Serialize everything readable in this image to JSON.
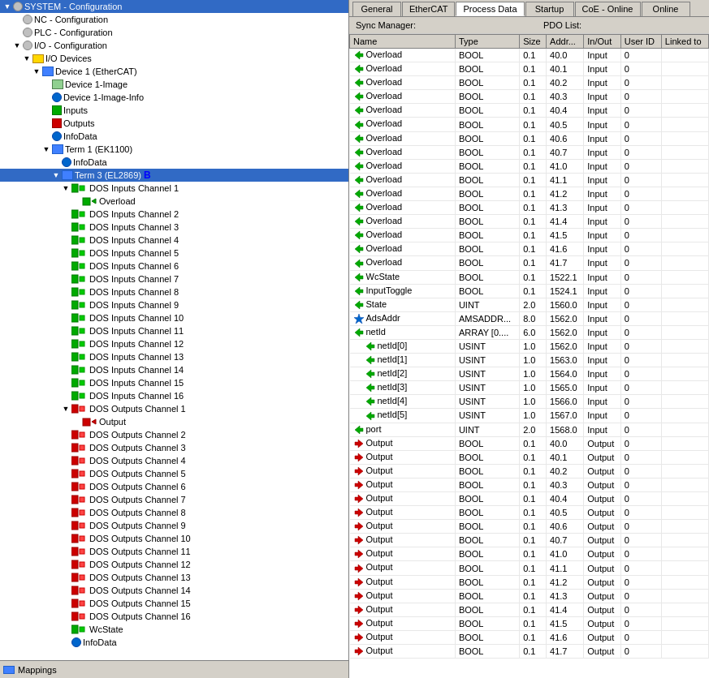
{
  "tabs": [
    {
      "label": "General",
      "active": false
    },
    {
      "label": "EtherCAT",
      "active": false
    },
    {
      "label": "Process Data",
      "active": true
    },
    {
      "label": "Startup",
      "active": false
    },
    {
      "label": "CoE - Online",
      "active": false
    },
    {
      "label": "Online",
      "active": false
    }
  ],
  "sync_manager_label": "Sync Manager:",
  "pdo_list_label": "PDO List:",
  "table_headers": [
    "Name",
    "Type",
    "Size",
    "Addr...",
    "In/Out",
    "User ID",
    "Linked to"
  ],
  "left_panel": {
    "tree": [
      {
        "id": "system",
        "label": "SYSTEM - Configuration",
        "indent": 0,
        "icon": "gear",
        "expand": true
      },
      {
        "id": "nc",
        "label": "NC - Configuration",
        "indent": 1,
        "icon": "gear",
        "expand": true
      },
      {
        "id": "plc",
        "label": "PLC - Configuration",
        "indent": 1,
        "icon": "gear",
        "expand": true
      },
      {
        "id": "io",
        "label": "I/O - Configuration",
        "indent": 1,
        "icon": "gear",
        "expand": true
      },
      {
        "id": "io-devices",
        "label": "I/O Devices",
        "indent": 2,
        "icon": "folder",
        "expand": true
      },
      {
        "id": "device1",
        "label": "Device 1 (EtherCAT)",
        "indent": 3,
        "icon": "device",
        "expand": true
      },
      {
        "id": "device1-image",
        "label": "Device 1-Image",
        "indent": 4,
        "icon": "image",
        "expand": false
      },
      {
        "id": "device1-image-info",
        "label": "Device 1-Image-Info",
        "indent": 4,
        "icon": "info",
        "expand": false
      },
      {
        "id": "inputs",
        "label": "Inputs",
        "indent": 4,
        "icon": "input-green",
        "expand": false
      },
      {
        "id": "outputs",
        "label": "Outputs",
        "indent": 4,
        "icon": "output-red",
        "expand": false
      },
      {
        "id": "infodata",
        "label": "InfoData",
        "indent": 4,
        "icon": "info-blue",
        "expand": false
      },
      {
        "id": "term1",
        "label": "Term 1 (EK1100)",
        "indent": 4,
        "icon": "device",
        "expand": true
      },
      {
        "id": "term1-infodata",
        "label": "InfoData",
        "indent": 5,
        "icon": "info-blue",
        "expand": false
      },
      {
        "id": "term3",
        "label": "Term 3 (EL2869)",
        "indent": 5,
        "icon": "device",
        "expand": true,
        "selected": true
      },
      {
        "id": "dos-ch1",
        "label": "DOS Inputs Channel 1",
        "indent": 6,
        "icon": "channel-green",
        "expand": true
      },
      {
        "id": "overload",
        "label": "Overload",
        "indent": 7,
        "icon": "overload-green",
        "expand": false
      },
      {
        "id": "dos-ch2",
        "label": "DOS Inputs Channel 2",
        "indent": 6,
        "icon": "channel-green",
        "expand": false
      },
      {
        "id": "dos-ch3",
        "label": "DOS Inputs Channel 3",
        "indent": 6,
        "icon": "channel-green",
        "expand": false
      },
      {
        "id": "dos-ch4",
        "label": "DOS Inputs Channel 4",
        "indent": 6,
        "icon": "channel-green",
        "expand": false
      },
      {
        "id": "dos-ch5",
        "label": "DOS Inputs Channel 5",
        "indent": 6,
        "icon": "channel-green",
        "expand": false
      },
      {
        "id": "dos-ch6",
        "label": "DOS Inputs Channel 6",
        "indent": 6,
        "icon": "channel-green",
        "expand": false
      },
      {
        "id": "dos-ch7",
        "label": "DOS Inputs Channel 7",
        "indent": 6,
        "icon": "channel-green",
        "expand": false
      },
      {
        "id": "dos-ch8",
        "label": "DOS Inputs Channel 8",
        "indent": 6,
        "icon": "channel-green",
        "expand": false
      },
      {
        "id": "dos-ch9",
        "label": "DOS Inputs Channel 9",
        "indent": 6,
        "icon": "channel-green",
        "expand": false
      },
      {
        "id": "dos-ch10",
        "label": "DOS Inputs Channel 10",
        "indent": 6,
        "icon": "channel-green",
        "expand": false
      },
      {
        "id": "dos-ch11",
        "label": "DOS Inputs Channel 11",
        "indent": 6,
        "icon": "channel-green",
        "expand": false
      },
      {
        "id": "dos-ch12",
        "label": "DOS Inputs Channel 12",
        "indent": 6,
        "icon": "channel-green",
        "expand": false
      },
      {
        "id": "dos-ch13",
        "label": "DOS Inputs Channel 13",
        "indent": 6,
        "icon": "channel-green",
        "expand": false
      },
      {
        "id": "dos-ch14",
        "label": "DOS Inputs Channel 14",
        "indent": 6,
        "icon": "channel-green",
        "expand": false
      },
      {
        "id": "dos-ch15",
        "label": "DOS Inputs Channel 15",
        "indent": 6,
        "icon": "channel-green",
        "expand": false
      },
      {
        "id": "dos-ch16",
        "label": "DOS Inputs Channel 16",
        "indent": 6,
        "icon": "channel-green",
        "expand": false
      },
      {
        "id": "dos-out-ch1",
        "label": "DOS Outputs Channel 1",
        "indent": 6,
        "icon": "channel-red",
        "expand": true
      },
      {
        "id": "output",
        "label": "Output",
        "indent": 7,
        "icon": "output-red-sm",
        "expand": false
      },
      {
        "id": "dos-out-ch2",
        "label": "DOS Outputs Channel 2",
        "indent": 6,
        "icon": "channel-red",
        "expand": false
      },
      {
        "id": "dos-out-ch3",
        "label": "DOS Outputs Channel 3",
        "indent": 6,
        "icon": "channel-red",
        "expand": false
      },
      {
        "id": "dos-out-ch4",
        "label": "DOS Outputs Channel 4",
        "indent": 6,
        "icon": "channel-red",
        "expand": false
      },
      {
        "id": "dos-out-ch5",
        "label": "DOS Outputs Channel 5",
        "indent": 6,
        "icon": "channel-red",
        "expand": false
      },
      {
        "id": "dos-out-ch6",
        "label": "DOS Outputs Channel 6",
        "indent": 6,
        "icon": "channel-red",
        "expand": false
      },
      {
        "id": "dos-out-ch7",
        "label": "DOS Outputs Channel 7",
        "indent": 6,
        "icon": "channel-red",
        "expand": false
      },
      {
        "id": "dos-out-ch8",
        "label": "DOS Outputs Channel 8",
        "indent": 6,
        "icon": "channel-red",
        "expand": false
      },
      {
        "id": "dos-out-ch9",
        "label": "DOS Outputs Channel 9",
        "indent": 6,
        "icon": "channel-red",
        "expand": false
      },
      {
        "id": "dos-out-ch10",
        "label": "DOS Outputs Channel 10",
        "indent": 6,
        "icon": "channel-red",
        "expand": false
      },
      {
        "id": "dos-out-ch11",
        "label": "DOS Outputs Channel 11",
        "indent": 6,
        "icon": "channel-red",
        "expand": false
      },
      {
        "id": "dos-out-ch12",
        "label": "DOS Outputs Channel 12",
        "indent": 6,
        "icon": "channel-red",
        "expand": false
      },
      {
        "id": "dos-out-ch13",
        "label": "DOS Outputs Channel 13",
        "indent": 6,
        "icon": "channel-red",
        "expand": false
      },
      {
        "id": "dos-out-ch14",
        "label": "DOS Outputs Channel 14",
        "indent": 6,
        "icon": "channel-red",
        "expand": false
      },
      {
        "id": "dos-out-ch15",
        "label": "DOS Outputs Channel 15",
        "indent": 6,
        "icon": "channel-red",
        "expand": false
      },
      {
        "id": "dos-out-ch16",
        "label": "DOS Outputs Channel 16",
        "indent": 6,
        "icon": "channel-red",
        "expand": false
      },
      {
        "id": "wcstate",
        "label": "WcState",
        "indent": 6,
        "icon": "channel-green",
        "expand": false
      },
      {
        "id": "infodata2",
        "label": "InfoData",
        "indent": 6,
        "icon": "info-blue",
        "expand": false
      }
    ],
    "mappings_label": "Mappings"
  },
  "pdo_rows": [
    {
      "name": "Overload",
      "indent": 0,
      "icon": "green-input",
      "type": "BOOL",
      "size": "0.1",
      "addr": "40.0",
      "inout": "Input",
      "userid": "0",
      "linked": ""
    },
    {
      "name": "Overload",
      "indent": 0,
      "icon": "green-input",
      "type": "BOOL",
      "size": "0.1",
      "addr": "40.1",
      "inout": "Input",
      "userid": "0",
      "linked": ""
    },
    {
      "name": "Overload",
      "indent": 0,
      "icon": "green-input",
      "type": "BOOL",
      "size": "0.1",
      "addr": "40.2",
      "inout": "Input",
      "userid": "0",
      "linked": ""
    },
    {
      "name": "Overload",
      "indent": 0,
      "icon": "green-input",
      "type": "BOOL",
      "size": "0.1",
      "addr": "40.3",
      "inout": "Input",
      "userid": "0",
      "linked": ""
    },
    {
      "name": "Overload",
      "indent": 0,
      "icon": "green-input",
      "type": "BOOL",
      "size": "0.1",
      "addr": "40.4",
      "inout": "Input",
      "userid": "0",
      "linked": ""
    },
    {
      "name": "Overload",
      "indent": 0,
      "icon": "green-input",
      "type": "BOOL",
      "size": "0.1",
      "addr": "40.5",
      "inout": "Input",
      "userid": "0",
      "linked": ""
    },
    {
      "name": "Overload",
      "indent": 0,
      "icon": "green-input",
      "type": "BOOL",
      "size": "0.1",
      "addr": "40.6",
      "inout": "Input",
      "userid": "0",
      "linked": ""
    },
    {
      "name": "Overload",
      "indent": 0,
      "icon": "green-input",
      "type": "BOOL",
      "size": "0.1",
      "addr": "40.7",
      "inout": "Input",
      "userid": "0",
      "linked": ""
    },
    {
      "name": "Overload",
      "indent": 0,
      "icon": "green-input",
      "type": "BOOL",
      "size": "0.1",
      "addr": "41.0",
      "inout": "Input",
      "userid": "0",
      "linked": ""
    },
    {
      "name": "Overload",
      "indent": 0,
      "icon": "green-input",
      "type": "BOOL",
      "size": "0.1",
      "addr": "41.1",
      "inout": "Input",
      "userid": "0",
      "linked": ""
    },
    {
      "name": "Overload",
      "indent": 0,
      "icon": "green-input",
      "type": "BOOL",
      "size": "0.1",
      "addr": "41.2",
      "inout": "Input",
      "userid": "0",
      "linked": ""
    },
    {
      "name": "Overload",
      "indent": 0,
      "icon": "green-input",
      "type": "BOOL",
      "size": "0.1",
      "addr": "41.3",
      "inout": "Input",
      "userid": "0",
      "linked": ""
    },
    {
      "name": "Overload",
      "indent": 0,
      "icon": "green-input",
      "type": "BOOL",
      "size": "0.1",
      "addr": "41.4",
      "inout": "Input",
      "userid": "0",
      "linked": ""
    },
    {
      "name": "Overload",
      "indent": 0,
      "icon": "green-input",
      "type": "BOOL",
      "size": "0.1",
      "addr": "41.5",
      "inout": "Input",
      "userid": "0",
      "linked": ""
    },
    {
      "name": "Overload",
      "indent": 0,
      "icon": "green-input",
      "type": "BOOL",
      "size": "0.1",
      "addr": "41.6",
      "inout": "Input",
      "userid": "0",
      "linked": ""
    },
    {
      "name": "Overload",
      "indent": 0,
      "icon": "green-input",
      "type": "BOOL",
      "size": "0.1",
      "addr": "41.7",
      "inout": "Input",
      "userid": "0",
      "linked": ""
    },
    {
      "name": "WcState",
      "indent": 0,
      "icon": "green-input",
      "type": "BOOL",
      "size": "0.1",
      "addr": "1522.1",
      "inout": "Input",
      "userid": "0",
      "linked": ""
    },
    {
      "name": "InputToggle",
      "indent": 0,
      "icon": "green-input",
      "type": "BOOL",
      "size": "0.1",
      "addr": "1524.1",
      "inout": "Input",
      "userid": "0",
      "linked": ""
    },
    {
      "name": "State",
      "indent": 0,
      "icon": "green-input",
      "type": "UINT",
      "size": "2.0",
      "addr": "1560.0",
      "inout": "Input",
      "userid": "0",
      "linked": ""
    },
    {
      "name": "AdsAddr",
      "indent": 0,
      "icon": "blue-star",
      "type": "AMSADDR...",
      "size": "8.0",
      "addr": "1562.0",
      "inout": "Input",
      "userid": "0",
      "linked": ""
    },
    {
      "name": "netId",
      "indent": 0,
      "icon": "green-input",
      "type": "ARRAY [0....",
      "size": "6.0",
      "addr": "1562.0",
      "inout": "Input",
      "userid": "0",
      "linked": ""
    },
    {
      "name": "netId[0]",
      "indent": 1,
      "icon": "green-input",
      "type": "USINT",
      "size": "1.0",
      "addr": "1562.0",
      "inout": "Input",
      "userid": "0",
      "linked": ""
    },
    {
      "name": "netId[1]",
      "indent": 1,
      "icon": "green-input",
      "type": "USINT",
      "size": "1.0",
      "addr": "1563.0",
      "inout": "Input",
      "userid": "0",
      "linked": ""
    },
    {
      "name": "netId[2]",
      "indent": 1,
      "icon": "green-input",
      "type": "USINT",
      "size": "1.0",
      "addr": "1564.0",
      "inout": "Input",
      "userid": "0",
      "linked": ""
    },
    {
      "name": "netId[3]",
      "indent": 1,
      "icon": "green-input",
      "type": "USINT",
      "size": "1.0",
      "addr": "1565.0",
      "inout": "Input",
      "userid": "0",
      "linked": ""
    },
    {
      "name": "netId[4]",
      "indent": 1,
      "icon": "green-input",
      "type": "USINT",
      "size": "1.0",
      "addr": "1566.0",
      "inout": "Input",
      "userid": "0",
      "linked": ""
    },
    {
      "name": "netId[5]",
      "indent": 1,
      "icon": "green-input",
      "type": "USINT",
      "size": "1.0",
      "addr": "1567.0",
      "inout": "Input",
      "userid": "0",
      "linked": ""
    },
    {
      "name": "port",
      "indent": 0,
      "icon": "green-input",
      "type": "UINT",
      "size": "2.0",
      "addr": "1568.0",
      "inout": "Input",
      "userid": "0",
      "linked": ""
    },
    {
      "name": "Output",
      "indent": 0,
      "icon": "red-output",
      "type": "BOOL",
      "size": "0.1",
      "addr": "40.0",
      "inout": "Output",
      "userid": "0",
      "linked": ""
    },
    {
      "name": "Output",
      "indent": 0,
      "icon": "red-output",
      "type": "BOOL",
      "size": "0.1",
      "addr": "40.1",
      "inout": "Output",
      "userid": "0",
      "linked": ""
    },
    {
      "name": "Output",
      "indent": 0,
      "icon": "red-output",
      "type": "BOOL",
      "size": "0.1",
      "addr": "40.2",
      "inout": "Output",
      "userid": "0",
      "linked": ""
    },
    {
      "name": "Output",
      "indent": 0,
      "icon": "red-output",
      "type": "BOOL",
      "size": "0.1",
      "addr": "40.3",
      "inout": "Output",
      "userid": "0",
      "linked": ""
    },
    {
      "name": "Output",
      "indent": 0,
      "icon": "red-output",
      "type": "BOOL",
      "size": "0.1",
      "addr": "40.4",
      "inout": "Output",
      "userid": "0",
      "linked": ""
    },
    {
      "name": "Output",
      "indent": 0,
      "icon": "red-output",
      "type": "BOOL",
      "size": "0.1",
      "addr": "40.5",
      "inout": "Output",
      "userid": "0",
      "linked": ""
    },
    {
      "name": "Output",
      "indent": 0,
      "icon": "red-output",
      "type": "BOOL",
      "size": "0.1",
      "addr": "40.6",
      "inout": "Output",
      "userid": "0",
      "linked": ""
    },
    {
      "name": "Output",
      "indent": 0,
      "icon": "red-output",
      "type": "BOOL",
      "size": "0.1",
      "addr": "40.7",
      "inout": "Output",
      "userid": "0",
      "linked": ""
    },
    {
      "name": "Output",
      "indent": 0,
      "icon": "red-output",
      "type": "BOOL",
      "size": "0.1",
      "addr": "41.0",
      "inout": "Output",
      "userid": "0",
      "linked": ""
    },
    {
      "name": "Output",
      "indent": 0,
      "icon": "red-output",
      "type": "BOOL",
      "size": "0.1",
      "addr": "41.1",
      "inout": "Output",
      "userid": "0",
      "linked": ""
    },
    {
      "name": "Output",
      "indent": 0,
      "icon": "red-output",
      "type": "BOOL",
      "size": "0.1",
      "addr": "41.2",
      "inout": "Output",
      "userid": "0",
      "linked": ""
    },
    {
      "name": "Output",
      "indent": 0,
      "icon": "red-output",
      "type": "BOOL",
      "size": "0.1",
      "addr": "41.3",
      "inout": "Output",
      "userid": "0",
      "linked": ""
    },
    {
      "name": "Output",
      "indent": 0,
      "icon": "red-output",
      "type": "BOOL",
      "size": "0.1",
      "addr": "41.4",
      "inout": "Output",
      "userid": "0",
      "linked": ""
    },
    {
      "name": "Output",
      "indent": 0,
      "icon": "red-output",
      "type": "BOOL",
      "size": "0.1",
      "addr": "41.5",
      "inout": "Output",
      "userid": "0",
      "linked": ""
    },
    {
      "name": "Output",
      "indent": 0,
      "icon": "red-output",
      "type": "BOOL",
      "size": "0.1",
      "addr": "41.6",
      "inout": "Output",
      "userid": "0",
      "linked": ""
    },
    {
      "name": "Output",
      "indent": 0,
      "icon": "red-output",
      "type": "BOOL",
      "size": "0.1",
      "addr": "41.7",
      "inout": "Output",
      "userid": "0",
      "linked": ""
    }
  ]
}
